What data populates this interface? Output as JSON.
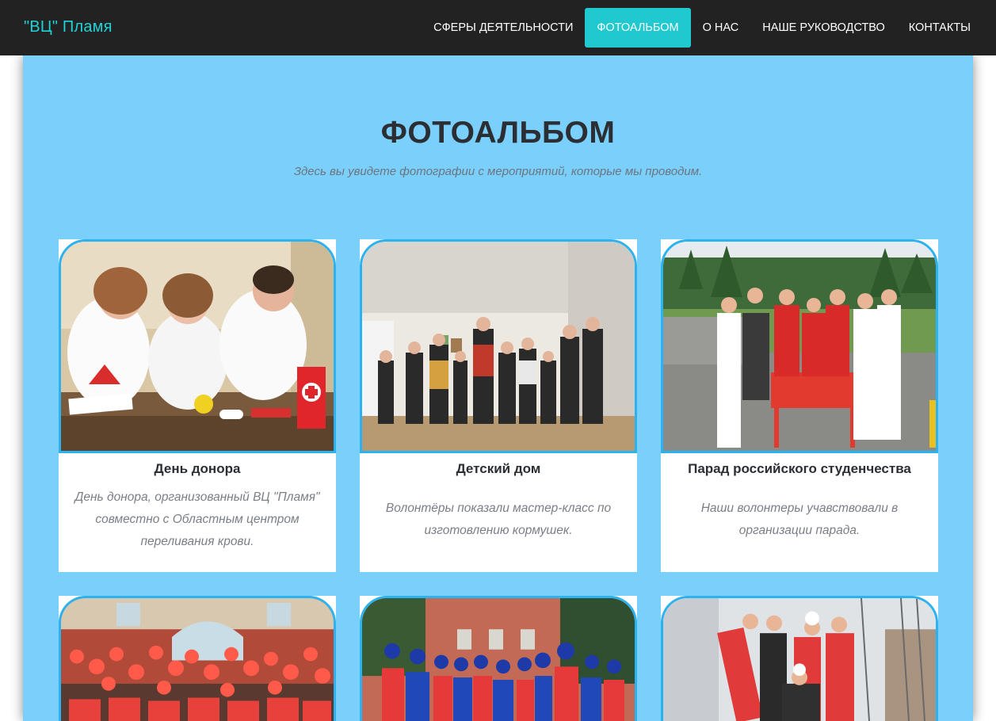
{
  "navbar": {
    "brand": "\"ВЦ\" Пламя",
    "items": [
      {
        "label": "СФЕРЫ ДЕЯТЕЛЬНОСТИ",
        "active": false
      },
      {
        "label": "ФОТОАЛЬБОМ",
        "active": true
      },
      {
        "label": "О НАС",
        "active": false
      },
      {
        "label": "НАШЕ РУКОВОДСТВО",
        "active": false
      },
      {
        "label": "КОНТАКТЫ",
        "active": false
      }
    ]
  },
  "header": {
    "title": "ФОТОАЛЬБОМ",
    "subtitle": "Здесь вы увидете фотографии с мероприятий, которые мы проводим."
  },
  "cards": [
    {
      "title": "День донора",
      "text": "День донора, организованный ВЦ \"Пламя\" совместно с Областным центром переливания крови."
    },
    {
      "title": "Детский дом",
      "text": "Волонтёры показали мастер-класс по изготовлению кормушек."
    },
    {
      "title": "Парад российского студенчества",
      "text": "Наши волонтеры учавствовали в организации парада."
    },
    {
      "title": "",
      "text": ""
    },
    {
      "title": "",
      "text": ""
    },
    {
      "title": "",
      "text": ""
    }
  ],
  "colors": {
    "navbar_bg": "#222222",
    "brand": "#20d2d8",
    "nav_active": "#1fc9cf",
    "page_bg": "#7acffb",
    "card_border": "#2ab3f0"
  }
}
